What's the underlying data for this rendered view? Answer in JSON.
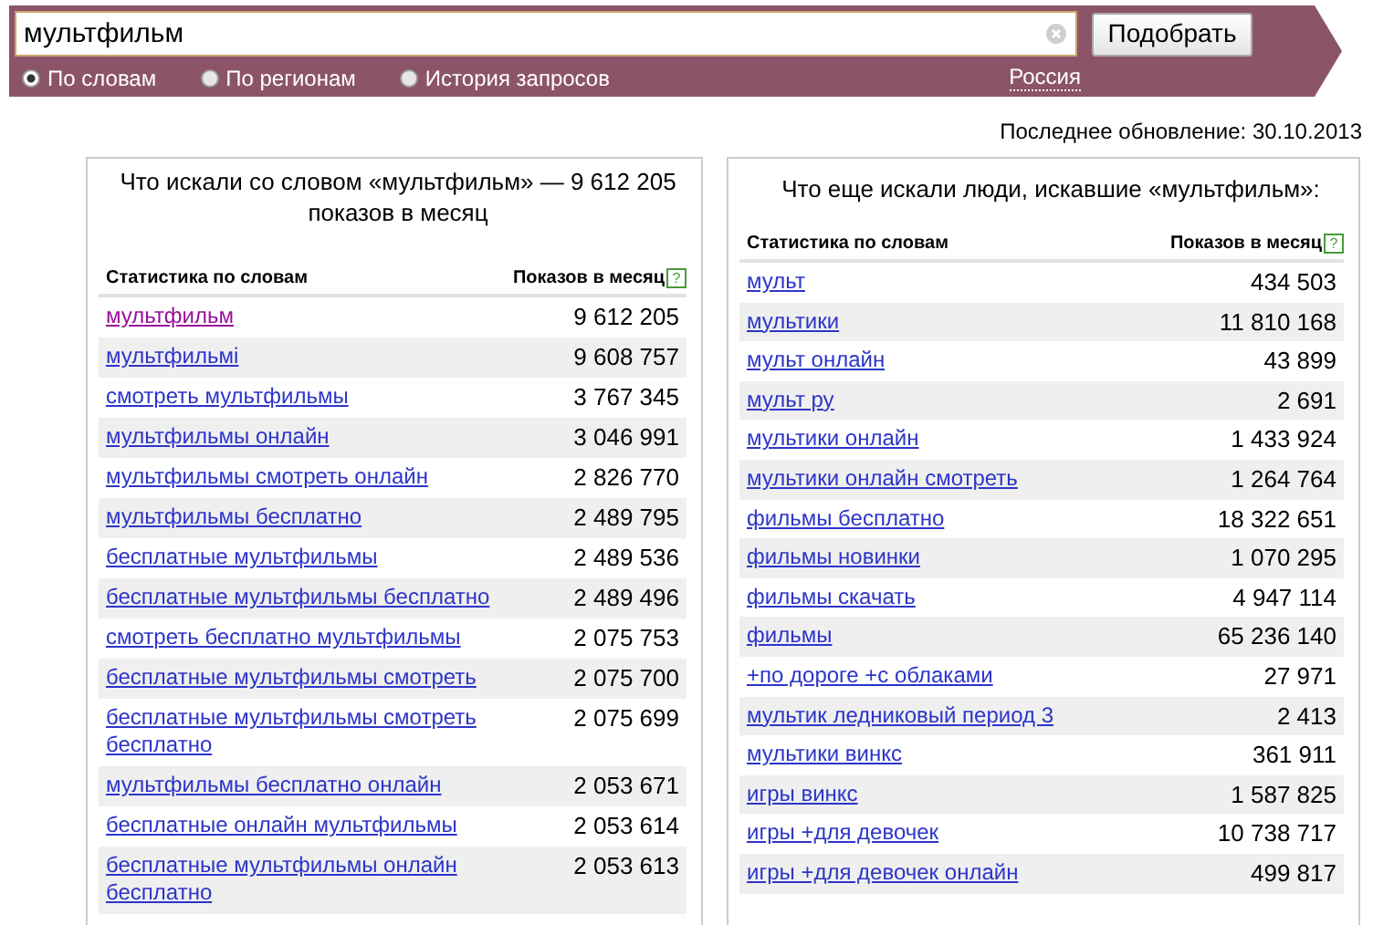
{
  "search": {
    "value": "мультфильм",
    "button": "Подобрать"
  },
  "modes": [
    {
      "label": "По словам",
      "selected": true
    },
    {
      "label": "По регионам",
      "selected": false
    },
    {
      "label": "История запросов",
      "selected": false
    }
  ],
  "region": "Россия",
  "last_update": "Последнее обновление: 30.10.2013",
  "panels": [
    {
      "title": "Что искали со словом «мультфильм» — 9 612 205 показов в месяц",
      "columns": [
        "Статистика по словам",
        "Показов в месяц"
      ],
      "help": "?",
      "rows": [
        {
          "query": "мультфильм",
          "count": "9 612 205",
          "visited": true
        },
        {
          "query": "мультфильмі",
          "count": "9 608 757",
          "visited": false
        },
        {
          "query": "смотреть мультфильмы",
          "count": "3 767 345",
          "visited": false
        },
        {
          "query": "мультфильмы онлайн",
          "count": "3 046 991",
          "visited": false
        },
        {
          "query": "мультфильмы смотреть онлайн",
          "count": "2 826 770",
          "visited": false
        },
        {
          "query": "мультфильмы бесплатно",
          "count": "2 489 795",
          "visited": false
        },
        {
          "query": "бесплатные мультфильмы",
          "count": "2 489 536",
          "visited": false
        },
        {
          "query": "бесплатные мультфильмы бесплатно",
          "count": "2 489 496",
          "visited": false
        },
        {
          "query": "смотреть бесплатно мультфильмы",
          "count": "2 075 753",
          "visited": false
        },
        {
          "query": "бесплатные мультфильмы смотреть",
          "count": "2 075 700",
          "visited": false
        },
        {
          "query": "бесплатные мультфильмы смотреть бесплатно",
          "count": "2 075 699",
          "visited": false
        },
        {
          "query": "мультфильмы бесплатно онлайн",
          "count": "2 053 671",
          "visited": false
        },
        {
          "query": "бесплатные онлайн мультфильмы",
          "count": "2 053 614",
          "visited": false
        },
        {
          "query": "бесплатные мультфильмы онлайн бесплатно",
          "count": "2 053 613",
          "visited": false
        }
      ]
    },
    {
      "title": "Что еще искали люди, искавшие «мультфильм»:",
      "columns": [
        "Статистика по словам",
        "Показов в месяц"
      ],
      "help": "?",
      "rows": [
        {
          "query": "мульт",
          "count": "434 503",
          "visited": false
        },
        {
          "query": "мультики",
          "count": "11 810 168",
          "visited": false
        },
        {
          "query": "мульт онлайн",
          "count": "43 899",
          "visited": false
        },
        {
          "query": "мульт ру",
          "count": "2 691",
          "visited": false
        },
        {
          "query": "мультики онлайн",
          "count": "1 433 924",
          "visited": false
        },
        {
          "query": "мультики онлайн смотреть",
          "count": "1 264 764",
          "visited": false
        },
        {
          "query": "фильмы бесплатно",
          "count": "18 322 651",
          "visited": false
        },
        {
          "query": "фильмы новинки",
          "count": "1 070 295",
          "visited": false
        },
        {
          "query": "фильмы скачать",
          "count": "4 947 114",
          "visited": false
        },
        {
          "query": "фильмы",
          "count": "65 236 140",
          "visited": false
        },
        {
          "query": "+по дороге +с облаками",
          "count": "27 971",
          "visited": false
        },
        {
          "query": "мультик ледниковый период 3",
          "count": "2 413",
          "visited": false
        },
        {
          "query": "мультики винкс",
          "count": "361 911",
          "visited": false
        },
        {
          "query": "игры винкс",
          "count": "1 587 825",
          "visited": false
        },
        {
          "query": "игры +для девочек",
          "count": "10 738 717",
          "visited": false
        },
        {
          "query": "игры +для девочек онлайн",
          "count": "499 817",
          "visited": false
        }
      ]
    }
  ]
}
